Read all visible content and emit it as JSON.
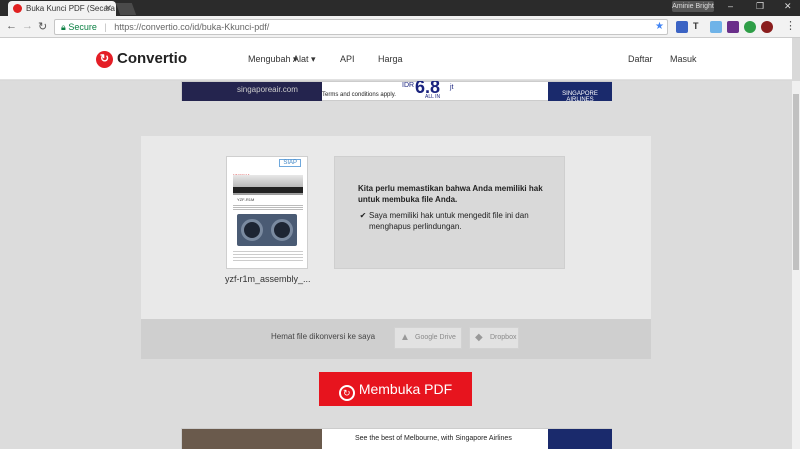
{
  "browser": {
    "tab_title": "Buka Kunci PDF (Secara",
    "tab_close_icon": "close-icon",
    "profile_name": "Aminie Bright",
    "url_secure_label": "Secure",
    "url_text": "https://convertio.co/id/buka-Kkunci-pdf/",
    "icons": [
      "back-arrow-icon",
      "forward-arrow-icon",
      "reload-icon",
      "lock-icon",
      "star-icon"
    ]
  },
  "header": {
    "logo_text": "Convertio",
    "nav": [
      "Mengubah ▾",
      "Alat ▾",
      "API",
      "Harga"
    ],
    "login": "Daftar",
    "register": "Masuk"
  },
  "ad_top": {
    "site_text": "singaporeair.com",
    "terms": "Terms and conditions apply.",
    "currency": "IDR",
    "price": "6.8",
    "unit": "jt",
    "allin": "ALL IN",
    "brand": "SINGAPORE AIRLINES"
  },
  "file": {
    "status_badge": "SIAP",
    "name": "yzf-r1m_assembly_...",
    "doc_title": "YZF-R1M"
  },
  "consent": {
    "heading": "Kita perlu memastikan bahwa Anda memiliki hak untuk membuka file Anda.",
    "checkbox_label": "Saya memiliki hak untuk mengedit file ini dan menghapus perlindungan.",
    "checked": true
  },
  "save": {
    "label": "Hemat file dikonversi ke saya",
    "gdrive": "Google Drive",
    "dropbox": "Dropbox"
  },
  "action": {
    "open_label": "Membuka PDF"
  },
  "ad_bottom": {
    "text": "See the best of Melbourne, with Singapore Airlines"
  },
  "colors": {
    "brand_red": "#e7141e",
    "secure_green": "#0b8043"
  }
}
